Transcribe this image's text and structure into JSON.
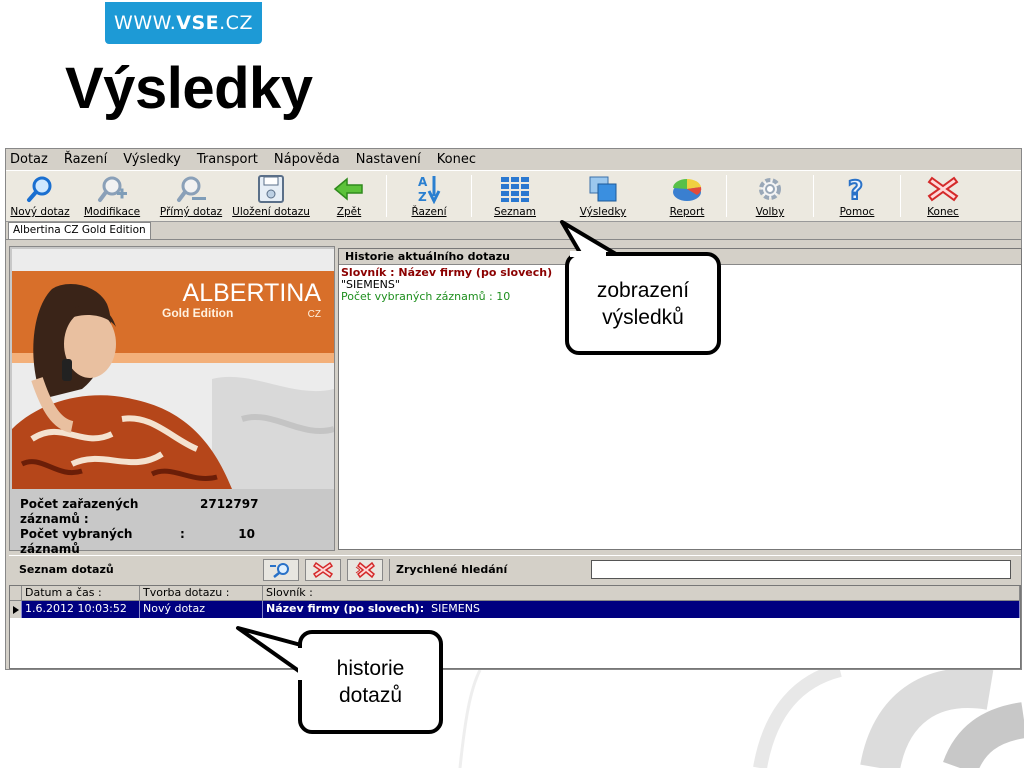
{
  "header": {
    "badge_prefix": "WWW.",
    "badge_bold": "VSE",
    "badge_suffix": ".CZ",
    "title": "Výsledky"
  },
  "menu": [
    "Dotaz",
    "Řazení",
    "Výsledky",
    "Transport",
    "Nápověda",
    "Nastavení",
    "Konec"
  ],
  "toolbar": [
    {
      "label": "Nový dotaz",
      "icon": "magnifier-icon"
    },
    {
      "label": "Modifikace",
      "icon": "magnifier-plus-icon"
    },
    {
      "label": "Přímý dotaz",
      "icon": "magnifier-line-icon"
    },
    {
      "label": "Uložení dotazu",
      "icon": "floppy-disk-icon"
    },
    {
      "label": "Zpět",
      "icon": "back-arrow-icon"
    },
    {
      "label": "Řazení",
      "icon": "sort-az-icon"
    },
    {
      "label": "Seznam",
      "icon": "grid-list-icon"
    },
    {
      "label": "Výsledky",
      "icon": "results-windows-icon"
    },
    {
      "label": "Report",
      "icon": "pie-report-icon"
    },
    {
      "label": "Volby",
      "icon": "gear-icon"
    },
    {
      "label": "Pomoc",
      "icon": "help-icon"
    },
    {
      "label": "Konec",
      "icon": "close-x-icon"
    }
  ],
  "tab": "Albertina CZ Gold Edition",
  "banner": {
    "brand": "ALBERTINA",
    "edition": "Gold Edition",
    "country": "CZ"
  },
  "counts": {
    "sorted_label": "Počet zařazených záznamů :",
    "sorted_value": "2712797",
    "selected_label": "Počet vybraných záznamů",
    "selected_colon": ":",
    "selected_value": "10"
  },
  "history": {
    "title": "Historie aktuálního dotazu",
    "line1": "Slovník :  Název firmy (po slovech)",
    "line2": "\"SIEMENS\"",
    "line3": "Počet vybraných záznamů : 10"
  },
  "queries": {
    "title": "Seznam dotazů",
    "quick_search": "Zrychlené hledání",
    "columns": [
      "Datum a čas :",
      "Tvorba dotazu :",
      "Slovník :"
    ],
    "row": {
      "datetime": "1.6.2012 10:03:52",
      "creation": "Nový dotaz",
      "dict_bold": "Název firmy (po slovech):",
      "dict_value": "SIEMENS"
    }
  },
  "callouts": {
    "results": [
      "zobrazení",
      "výsledků"
    ],
    "history": [
      "historie",
      "dotazů"
    ]
  },
  "colors": {
    "badge": "#1d9ad6",
    "selected_row": "#000080",
    "history_dict": "#8b0000",
    "history_count": "#1e8f1e"
  }
}
